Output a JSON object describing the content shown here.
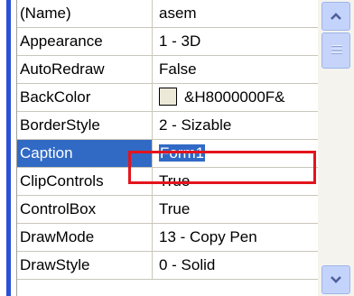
{
  "properties": [
    {
      "name": "(Name)",
      "value": "asem"
    },
    {
      "name": "Appearance",
      "value": "1 - 3D"
    },
    {
      "name": "AutoRedraw",
      "value": "False"
    },
    {
      "name": "BackColor",
      "value": "&H8000000F&",
      "swatch": "#ece9d8"
    },
    {
      "name": "BorderStyle",
      "value": "2 - Sizable"
    },
    {
      "name": "Caption",
      "value": "Form1",
      "selected": true
    },
    {
      "name": "ClipControls",
      "value": "True"
    },
    {
      "name": "ControlBox",
      "value": "True"
    },
    {
      "name": "DrawMode",
      "value": "13 - Copy Pen"
    },
    {
      "name": "DrawStyle",
      "value": "0 - Solid"
    }
  ],
  "colors": {
    "selection": "#316ac5",
    "highlight_border": "#e3141d",
    "left_bar": "#2b4fd6"
  }
}
